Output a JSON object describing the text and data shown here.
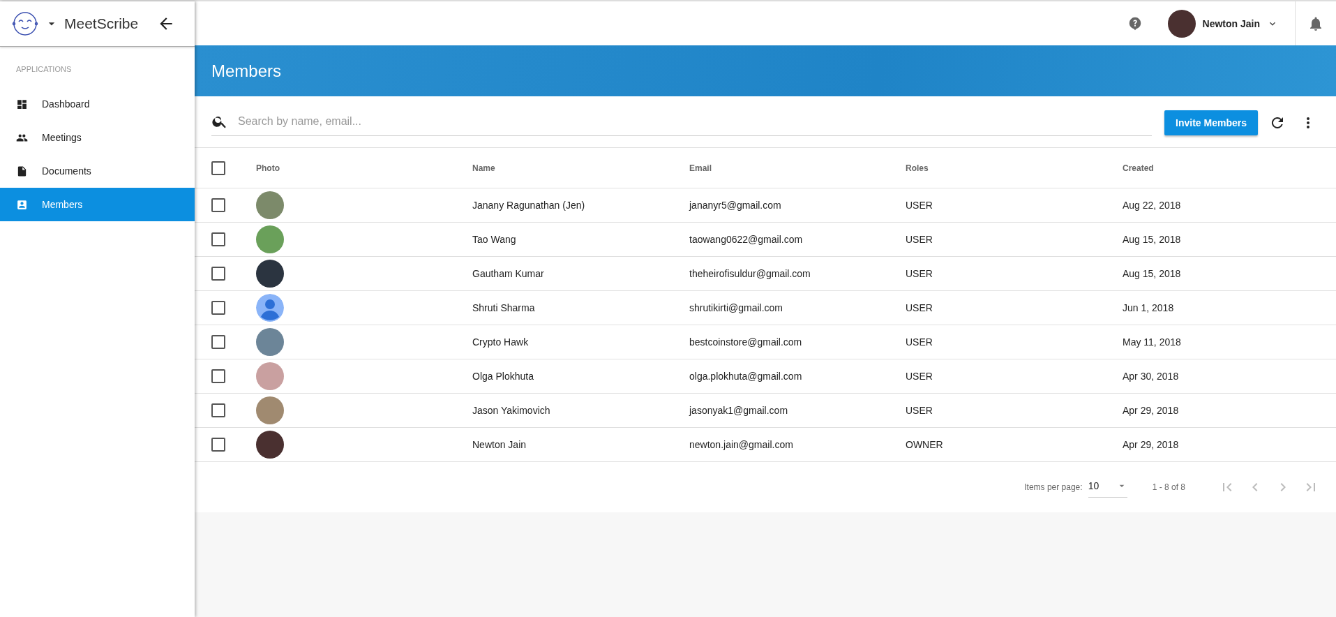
{
  "app": {
    "name": "MeetScribe"
  },
  "sidebar": {
    "section": "APPLICATIONS",
    "items": [
      {
        "label": "Dashboard",
        "selected": false
      },
      {
        "label": "Meetings",
        "selected": false
      },
      {
        "label": "Documents",
        "selected": false
      },
      {
        "label": "Members",
        "selected": true
      }
    ]
  },
  "user": {
    "name": "Newton Jain"
  },
  "page": {
    "title": "Members"
  },
  "search": {
    "placeholder": "Search by name, email..."
  },
  "invite_button": "Invite Members",
  "table": {
    "select_all": {
      "checked": false
    },
    "columns": [
      "Photo",
      "Name",
      "Email",
      "Roles",
      "Created"
    ],
    "rows": [
      {
        "checked": false,
        "name": "Janany Ragunathan (Jen)",
        "email": "jananyr5@gmail.com",
        "role": "USER",
        "created": "Aug 22, 2018"
      },
      {
        "checked": false,
        "name": "Tao Wang",
        "email": "taowang0622@gmail.com",
        "role": "USER",
        "created": "Aug 15, 2018"
      },
      {
        "checked": false,
        "name": "Gautham Kumar",
        "email": "theheirofisuldur@gmail.com",
        "role": "USER",
        "created": "Aug 15, 2018"
      },
      {
        "checked": false,
        "name": "Shruti Sharma",
        "email": "shrutikirti@gmail.com",
        "role": "USER",
        "created": "Jun 1, 2018"
      },
      {
        "checked": false,
        "name": "Crypto Hawk",
        "email": "bestcoinstore@gmail.com",
        "role": "USER",
        "created": "May 11, 2018"
      },
      {
        "checked": false,
        "name": "Olga Plokhuta",
        "email": "olga.plokhuta@gmail.com",
        "role": "USER",
        "created": "Apr 30, 2018"
      },
      {
        "checked": false,
        "name": "Jason Yakimovich",
        "email": "jasonyak1@gmail.com",
        "role": "USER",
        "created": "Apr 29, 2018"
      },
      {
        "checked": false,
        "name": "Newton Jain",
        "email": "newton.jain@gmail.com",
        "role": "OWNER",
        "created": "Apr 29, 2018"
      }
    ]
  },
  "paginator": {
    "label": "Items per page:",
    "page_size": "10",
    "range": "1 - 8 of 8",
    "buttons": [
      {
        "kind": "first",
        "disabled": true
      },
      {
        "kind": "previous",
        "disabled": true
      },
      {
        "kind": "next",
        "disabled": true
      },
      {
        "kind": "last",
        "disabled": true
      }
    ]
  }
}
